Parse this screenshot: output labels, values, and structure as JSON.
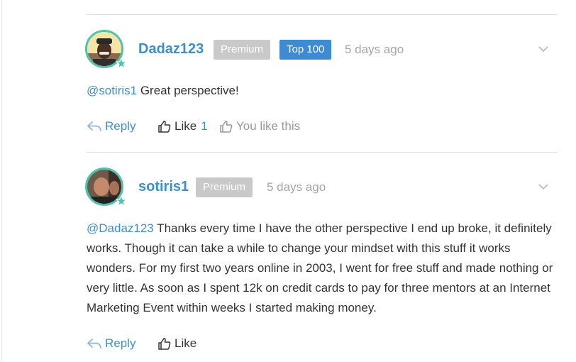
{
  "comments": [
    {
      "username": "Dadaz123",
      "badges": [
        "Premium",
        "Top 100"
      ],
      "timestamp": "5 days ago",
      "mention": "@sotiris1",
      "text": " Great perspective!",
      "reply_label": "Reply",
      "like_label": "Like",
      "like_count": "1",
      "you_like_label": "You like this"
    },
    {
      "username": "sotiris1",
      "badges": [
        "Premium"
      ],
      "timestamp": "5 days ago",
      "mention": "@Dadaz123",
      "text": " Thanks every time I have the other perspective I end up broke, it definitely works. Though it can take a while to change your mindset with this stuff it works wonders. For my first two years online in 2003, I went for free stuff and made nothing or very little. As soon as I spent 12k on credit cards to pay for three mentors at an Internet Marketing Event within weeks I started making money.",
      "reply_label": "Reply",
      "like_label": "Like"
    }
  ],
  "colors": {
    "accent": "#3d8fcc",
    "avatar_ring": "#4cc3ad",
    "premium_badge": "#c9c9c9",
    "top100_badge": "#3c8bd3"
  }
}
